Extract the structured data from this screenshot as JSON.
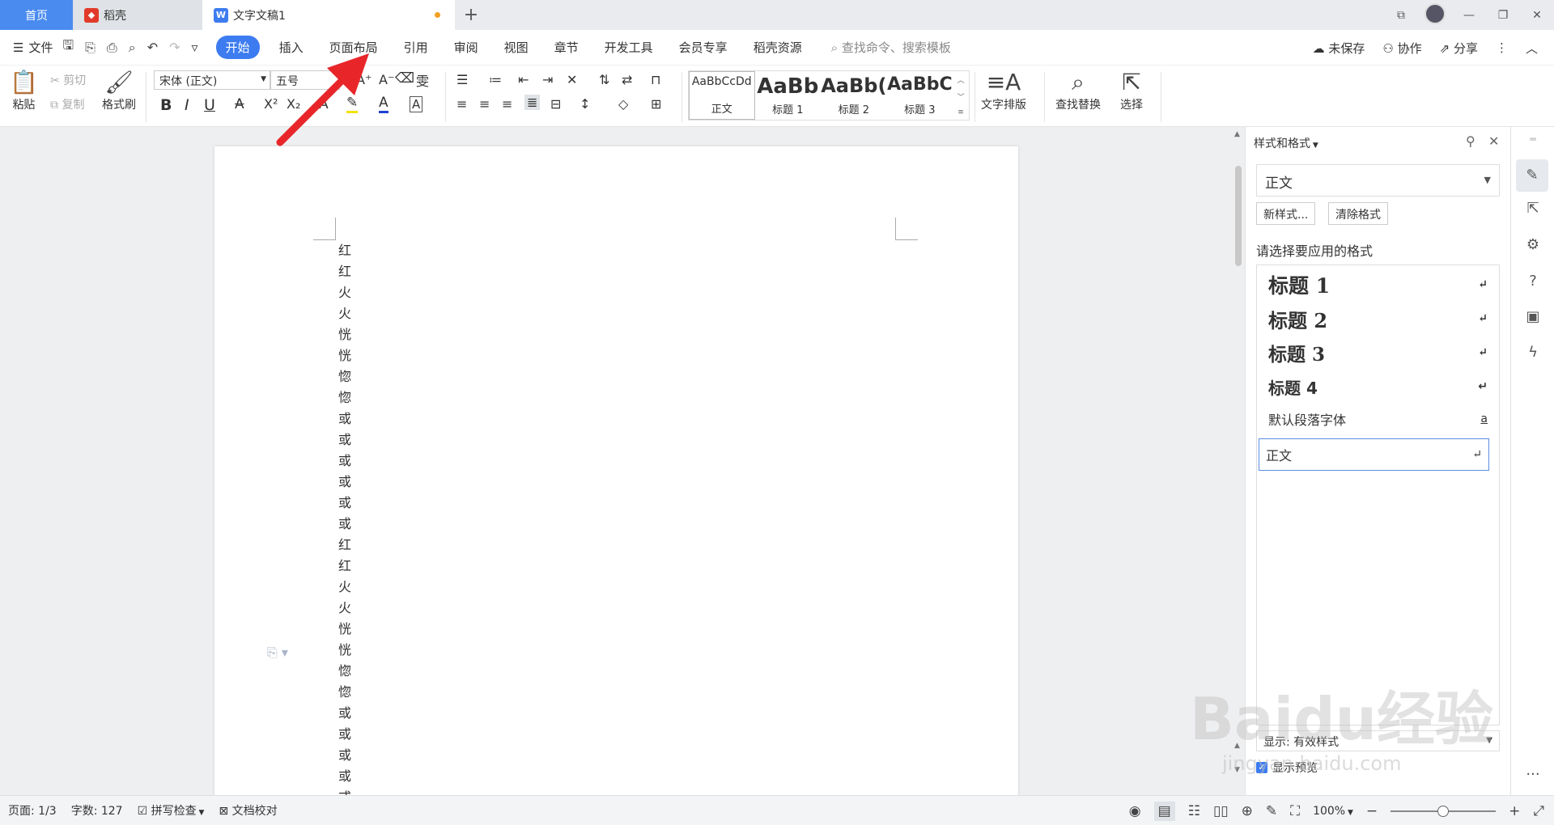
{
  "tabs": {
    "home": "首页",
    "daoke": "稻壳",
    "doc": "文字文稿1"
  },
  "menu": {
    "file": "文件",
    "tabs": [
      "开始",
      "插入",
      "页面布局",
      "引用",
      "审阅",
      "视图",
      "章节",
      "开发工具",
      "会员专享",
      "稻壳资源"
    ],
    "search": "查找命令、搜索模板",
    "unsaved": "未保存",
    "collab": "协作",
    "share": "分享"
  },
  "ribbon": {
    "paste": "粘贴",
    "cut": "剪切",
    "copy": "复制",
    "format_painter": "格式刷",
    "font": "宋体 (正文)",
    "size": "五号",
    "gallery": [
      {
        "preview": "AaBbCcDd",
        "name": "正文"
      },
      {
        "preview": "AaBb",
        "name": "标题 1"
      },
      {
        "preview": "AaBb(",
        "name": "标题 2"
      },
      {
        "preview": "AaBbC",
        "name": "标题 3"
      }
    ],
    "text_layout": "文字排版",
    "find_replace": "查找替换",
    "select": "选择"
  },
  "document": {
    "vertical_text": [
      "红",
      "红",
      "火",
      "火",
      "恍",
      "恍",
      "惚",
      "惚",
      "或",
      "或",
      "或",
      "或",
      "或",
      "或",
      "红",
      "红",
      "火",
      "火",
      "恍",
      "恍",
      "惚",
      "惚",
      "或",
      "或",
      "或",
      "或",
      "或"
    ]
  },
  "style_panel": {
    "title": "样式和格式",
    "current": "正文",
    "new_style": "新样式...",
    "clear_format": "清除格式",
    "prompt": "请选择要应用的格式",
    "styles": [
      {
        "name": "标题  1",
        "mark": "↵"
      },
      {
        "name": "标题  2",
        "mark": "↵"
      },
      {
        "name": "标题  3",
        "mark": "↵"
      },
      {
        "name": "标题  4",
        "mark": "↵"
      },
      {
        "name": "默认段落字体",
        "mark": "a"
      },
      {
        "name": "正文",
        "mark": "↵"
      }
    ],
    "show_label": "显示: 有效样式",
    "preview_label": "显示预览"
  },
  "status": {
    "page": "页面: 1/3",
    "words": "字数: 127",
    "spell": "拼写检查",
    "proof": "文档校对",
    "zoom": "100%",
    "zoom_level": 0.5
  },
  "watermark": {
    "logo": "Baidu经验",
    "url": "jingyan.baidu.com"
  },
  "colors": {
    "accent": "#3d7cf0",
    "arrow": "#e8262a",
    "home_tab": "#4a8bf0"
  }
}
